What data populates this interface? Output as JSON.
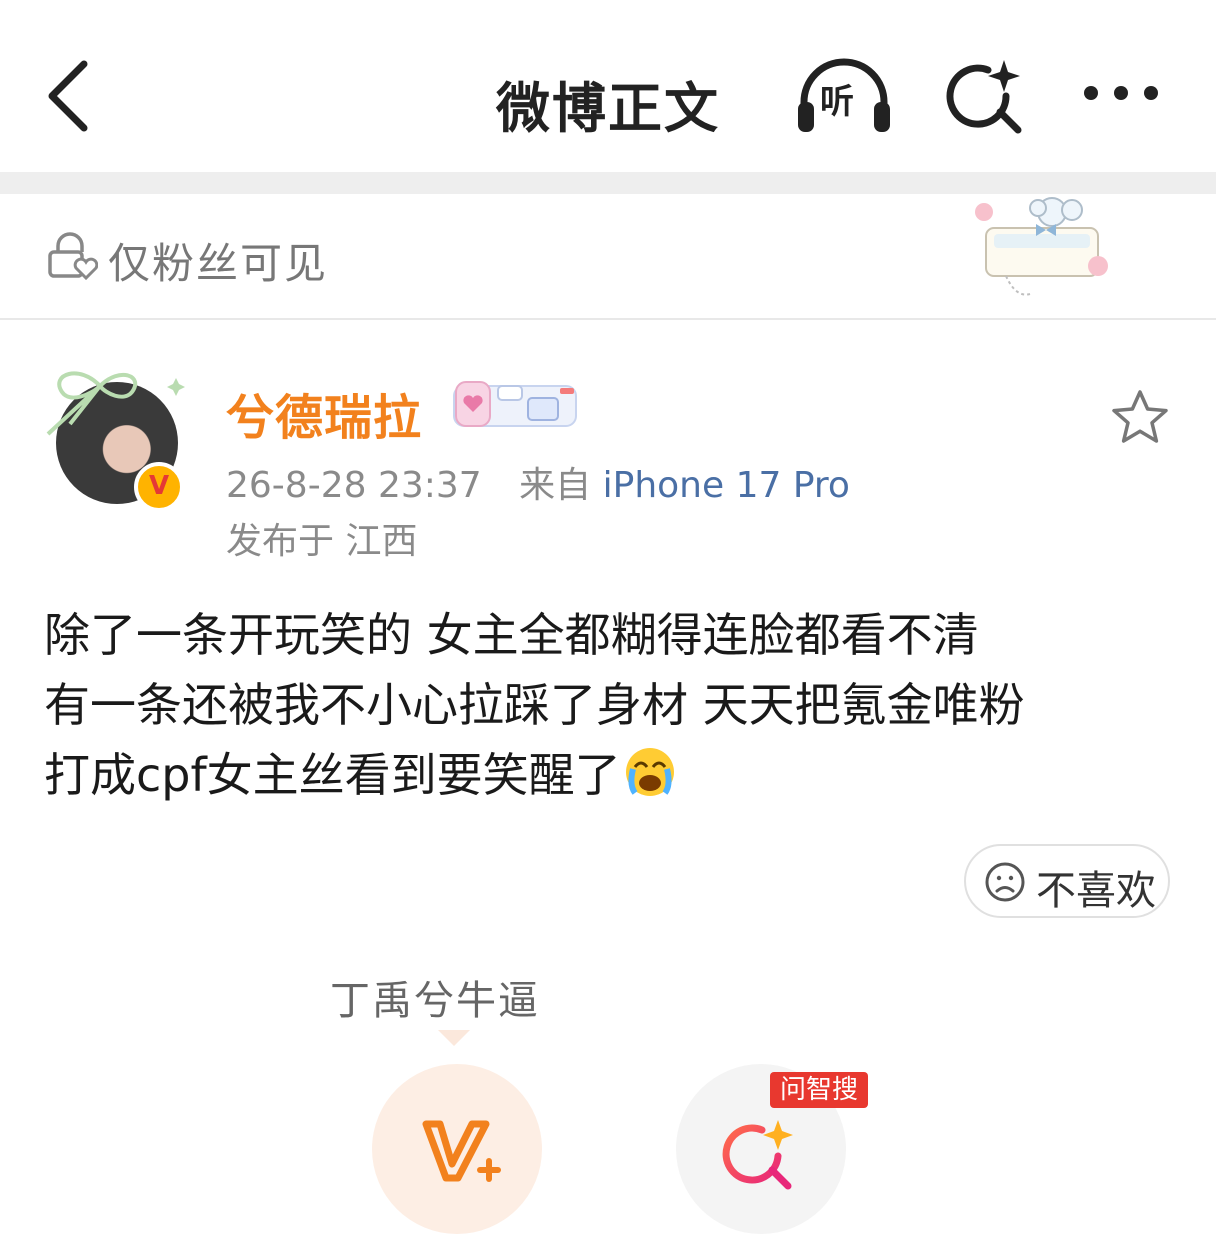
{
  "header": {
    "title": "微博正文",
    "listen_label": "听"
  },
  "visibility": {
    "label": "仅粉丝可见"
  },
  "post": {
    "author": "兮德瑞拉",
    "timestamp": "26-8-28 23:37",
    "source_prefix": "来自",
    "device": "iPhone 17 Pro",
    "location": "发布于 江西",
    "body_lines": [
      "除了一条开玩笑的 女主全都糊得连脸都看不清",
      "有一条还被我不小心拉踩了身材 天天把氪金唯粉",
      "打成cpf女主丝看到要笑醒了"
    ],
    "emoji": "crying-laughing-face"
  },
  "actions": {
    "dislike_label": "不喜欢",
    "tooltip": "丁禹兮牛逼",
    "ai_tag": "问智搜"
  },
  "colors": {
    "username": "#f2811d",
    "device_link": "#4a6fa5",
    "ai_tag": "#e8382f",
    "v_button_bg": "#fdeee4"
  }
}
